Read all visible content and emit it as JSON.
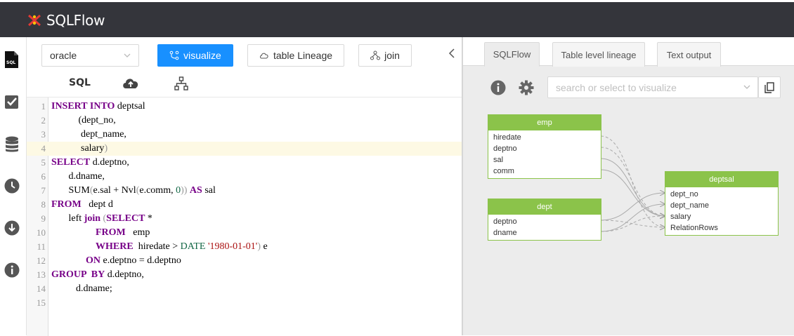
{
  "app": {
    "title": "SQLFlow"
  },
  "sidebar": {
    "items": [
      {
        "name": "sql-file-icon",
        "label": "SQL"
      },
      {
        "name": "checkbox-icon"
      },
      {
        "name": "database-icon"
      },
      {
        "name": "clock-icon"
      },
      {
        "name": "download-icon"
      },
      {
        "name": "info-icon"
      }
    ]
  },
  "toolbar": {
    "db_select_value": "oracle",
    "visualize_label": "visualize",
    "table_lineage_label": "table Lineage",
    "join_label": "join",
    "sql_tab_label": "SQL"
  },
  "editor": {
    "lines": [
      {
        "n": "1",
        "html": "<span class='kw'>INSERT INTO</span> deptsal"
      },
      {
        "n": "2",
        "html": "           (dept_no,"
      },
      {
        "n": "3",
        "html": "            dept_name,"
      },
      {
        "n": "4",
        "html": "            salary<span class='br'>)</span>",
        "hl": true
      },
      {
        "n": "5",
        "html": "<span class='kw'>SELECT</span> d.deptno,"
      },
      {
        "n": "6",
        "html": "       d.dname,"
      },
      {
        "n": "7",
        "html": "       SUM<span class='br'>(</span>e.sal + Nvl<span class='br'>(</span>e.comm, <span class='num'>0</span><span class='br'>))</span> <span class='kw'>AS</span> sal"
      },
      {
        "n": "8",
        "html": "<span class='kw'>FROM</span>   dept d"
      },
      {
        "n": "9",
        "html": "       left <span class='kw'>join</span> <span class='br'>(</span><span class='kw'>SELECT</span> *"
      },
      {
        "n": "10",
        "html": "                  <span class='kw'>FROM</span>   emp"
      },
      {
        "n": "11",
        "html": "                  <span class='kw'>WHERE</span>  hiredate &gt; <span class='num'>DATE</span> <span class='str'>'1980-01-01'</span><span class='br'>)</span> e"
      },
      {
        "n": "12",
        "html": "              <span class='kw'>ON</span> e.deptno = d.deptno"
      },
      {
        "n": "13",
        "html": "<span class='kw'>GROUP  BY</span> d.deptno,"
      },
      {
        "n": "14",
        "html": "          d.dname;"
      },
      {
        "n": "15",
        "html": ""
      }
    ]
  },
  "right_panel": {
    "tabs": [
      "SQLFlow",
      "Table level lineage",
      "Text output"
    ],
    "search_placeholder": "search or select to visualize",
    "nodes": {
      "emp": {
        "title": "emp",
        "rows": [
          "hiredate",
          "deptno",
          "sal",
          "comm"
        ]
      },
      "dept": {
        "title": "dept",
        "rows": [
          "deptno",
          "dname"
        ]
      },
      "deptsal": {
        "title": "deptsal",
        "rows": [
          "dept_no",
          "dept_name",
          "salary",
          "RelationRows"
        ]
      }
    }
  },
  "colors": {
    "topbar": "#34353b",
    "primary": "#1890ff",
    "node_green": "#8bc34a",
    "keyword": "#770088"
  }
}
